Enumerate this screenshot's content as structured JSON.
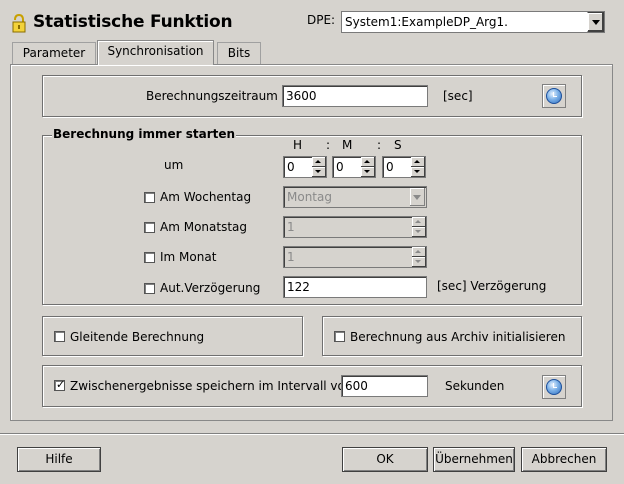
{
  "window": {
    "title": "Statistische Funktion"
  },
  "dpe": {
    "label": "DPE:",
    "value": "System1:ExampleDP_Arg1."
  },
  "tabs": [
    "Parameter",
    "Synchronisation",
    "Bits"
  ],
  "berechnungszeitraum": {
    "label": "Berechnungszeitraum",
    "value": "3600",
    "unit": "[sec]"
  },
  "berechnung_starten": {
    "title": "Berechnung immer starten",
    "time_headers": {
      "h": "H",
      "sep1": ":",
      "m": "M",
      "sep2": ":",
      "s": "S"
    },
    "um_label": "um",
    "h_value": "0",
    "m_value": "0",
    "s_value": "0",
    "wochentag": {
      "label": "Am Wochentag",
      "value": "Montag",
      "checked": false
    },
    "monatstag": {
      "label": "Am Monatstag",
      "value": "1",
      "checked": false
    },
    "monat": {
      "label": "Im Monat",
      "value": "1",
      "checked": false
    },
    "verzoegerung": {
      "label": "Aut.Verzögerung",
      "value": "122",
      "unit": "[sec] Verzögerung",
      "checked": false
    }
  },
  "gleitende": {
    "label": "Gleitende Berechnung",
    "checked": false
  },
  "archiv": {
    "label": "Berechnung aus Archiv initialisieren",
    "checked": false
  },
  "zwischen": {
    "label": "Zwischenergebnisse speichern im Intervall von",
    "value": "600",
    "unit": "Sekunden",
    "checked": true
  },
  "buttons": {
    "help": "Hilfe",
    "ok": "OK",
    "apply": "Übernehmen",
    "cancel": "Abbrechen"
  }
}
